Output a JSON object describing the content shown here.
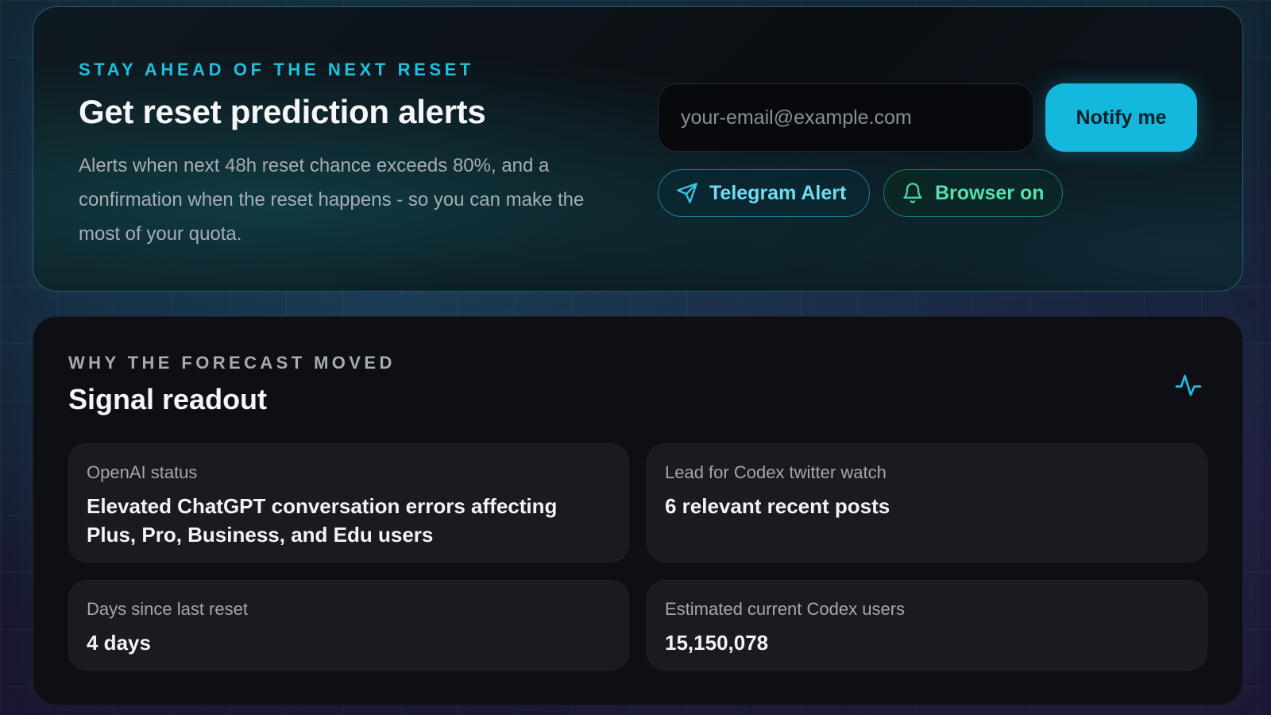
{
  "alert_card": {
    "eyebrow": "STAY AHEAD OF THE NEXT RESET",
    "title": "Get reset prediction alerts",
    "description": "Alerts when next 48h reset chance exceeds 80%, and a confirmation when the reset happens - so you can make the most of your quota.",
    "email_placeholder": "your-email@example.com",
    "email_value": "",
    "notify_label": "Notify me",
    "telegram_label": "Telegram Alert",
    "browser_label": "Browser on",
    "accent_color": "#13b8dc",
    "browser_color": "#55e0b0"
  },
  "signal_card": {
    "eyebrow": "WHY THE FORECAST MOVED",
    "title": "Signal readout",
    "icon": "activity-pulse-icon",
    "tiles": [
      {
        "label": "OpenAI status",
        "value": "Elevated ChatGPT conversation errors affecting Plus, Pro, Business, and Edu users"
      },
      {
        "label": "Lead for Codex twitter watch",
        "value": "6 relevant recent posts"
      },
      {
        "label": "Days since last reset",
        "value": "4 days"
      },
      {
        "label": "Estimated current Codex users",
        "value": "15,150,078"
      }
    ]
  }
}
